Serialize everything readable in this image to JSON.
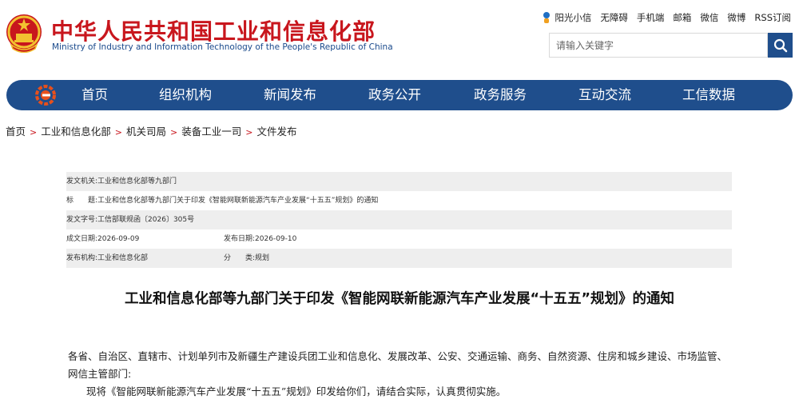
{
  "header": {
    "title": "中华人民共和国工业和信息化部",
    "subtitle": "Ministry of Industry and Information Technology of the People's Republic of China",
    "emblem_icon": "national-emblem-icon",
    "brand_color": "#c8161d",
    "top_links": [
      "阳光小信",
      "无障碍",
      "手机端",
      "邮箱",
      "微信",
      "微博",
      "RSS订阅"
    ],
    "search": {
      "placeholder": "请输入关键字",
      "value": "",
      "icon": "search-icon"
    }
  },
  "nav": {
    "color": "#1f4e8c",
    "logo_icon": "miit-logo-icon",
    "items": [
      "首页",
      "组织机构",
      "新闻发布",
      "政务公开",
      "政务服务",
      "互动交流",
      "工信数据"
    ]
  },
  "breadcrumb": [
    "首页",
    "工业和信息化部",
    "机关司局",
    "装备工业一司",
    "文件发布"
  ],
  "meta": {
    "issuer_label": "发文机关:",
    "issuer_value": "工业和信息化部等九部门",
    "title_label": "标　　题:",
    "title_value": "工业和信息化部等九部门关于印发《智能网联新能源汽车产业发展“十五五”规划》的通知",
    "doc_no_label": "发文字号:",
    "doc_no_value": "工信部联规函〔2026〕305号",
    "created_label": "成文日期:",
    "created_value": "2026-09-09",
    "published_label": "发布日期:",
    "published_value": "2026-09-10",
    "org_label": "发布机构:",
    "org_value": "工业和信息化部",
    "category_label": "分　　类:",
    "category_value": "规划"
  },
  "article": {
    "title": "工业和信息化部等九部门关于印发《智能网联新能源汽车产业发展“十五五”规划》的通知",
    "para1": "各省、自治区、直辖市、计划单列市及新疆生产建设兵团工业和信息化、发展改革、公安、交通运输、商务、自然资源、住房和城乡建设、市场监管、网信主管部门:",
    "para2": "现将《智能网联新能源汽车产业发展“十五五”规划》印发给你们，请结合实际，认真贯彻实施。"
  }
}
